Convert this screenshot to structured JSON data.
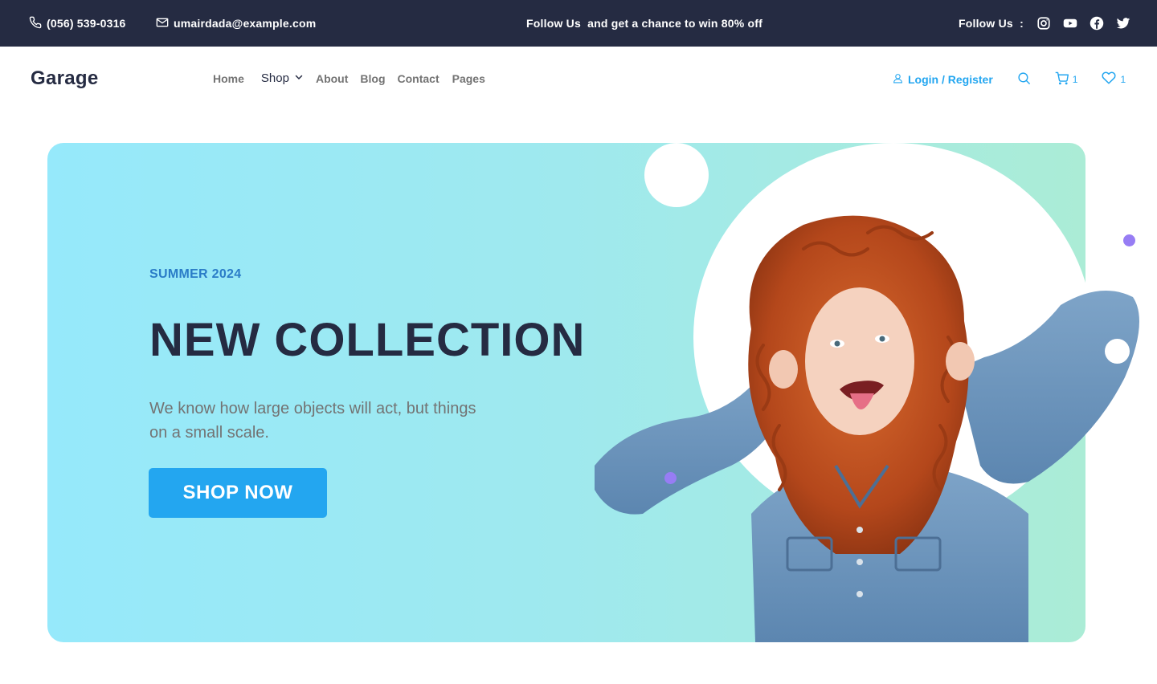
{
  "topbar": {
    "phone": "(056) 539-0316",
    "email": "umairdada@example.com",
    "promo": "Follow Us  and get a chance to win 80% off",
    "follow_label": "Follow Us  :",
    "social_icons": [
      "instagram-icon",
      "youtube-icon",
      "facebook-icon",
      "twitter-icon"
    ]
  },
  "nav": {
    "brand": "Garage",
    "menu": [
      "Home",
      "Shop",
      "About",
      "Blog",
      "Contact",
      "Pages"
    ],
    "login": "Login / Register",
    "cart_count": "1",
    "wishlist_count": "1"
  },
  "hero": {
    "season": "SUMMER 2024",
    "headline": "NEW COLLECTION",
    "lead": "We know how large objects will act, but things on a small scale.",
    "cta": "SHOP NOW"
  },
  "colors": {
    "topbar_bg": "#252b42",
    "primary": "#23a6f0",
    "dark_text": "#252b42",
    "muted_text": "#737373",
    "accent_purple": "#977df4"
  }
}
